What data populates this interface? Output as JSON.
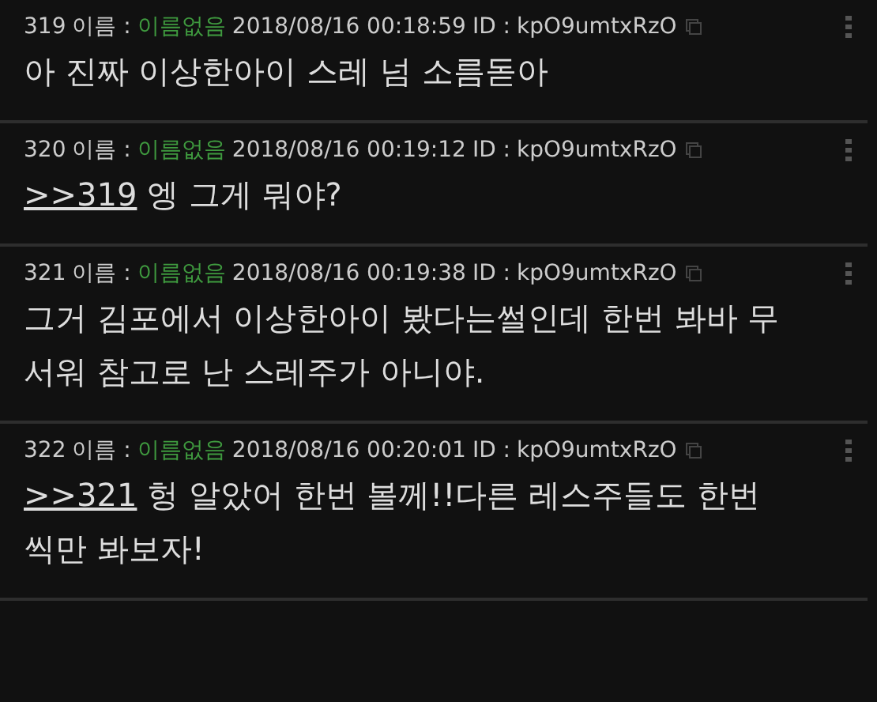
{
  "posts": [
    {
      "number": "319",
      "name_label": "이름 :",
      "name": "이름없음",
      "date": "2018/08/16 00:18:59",
      "id_label": "ID :",
      "id": "kpO9umtxRzO",
      "text": "아 진짜 이상한아이 스레 넘 소름돋아"
    },
    {
      "number": "320",
      "name_label": "이름 :",
      "name": "이름없음",
      "date": "2018/08/16 00:19:12",
      "id_label": "ID :",
      "id": "kpO9umtxRzO",
      "reply": ">>319",
      "text": "엥 그게 뭐야?"
    },
    {
      "number": "321",
      "name_label": "이름 :",
      "name": "이름없음",
      "date": "2018/08/16 00:19:38",
      "id_label": "ID :",
      "id": "kpO9umtxRzO",
      "text": "그거 김포에서 이상한아이 봤다는썰인데 한번 봐바 무서워 참고로 난 스레주가 아니야."
    },
    {
      "number": "322",
      "name_label": "이름 :",
      "name": "이름없음",
      "date": "2018/08/16 00:20:01",
      "id_label": "ID :",
      "id": "kpO9umtxRzO",
      "reply": ">>321",
      "text": "헝 알았어 한번 볼께!!다른 레스주들도 한번씩만 봐보자!"
    }
  ]
}
